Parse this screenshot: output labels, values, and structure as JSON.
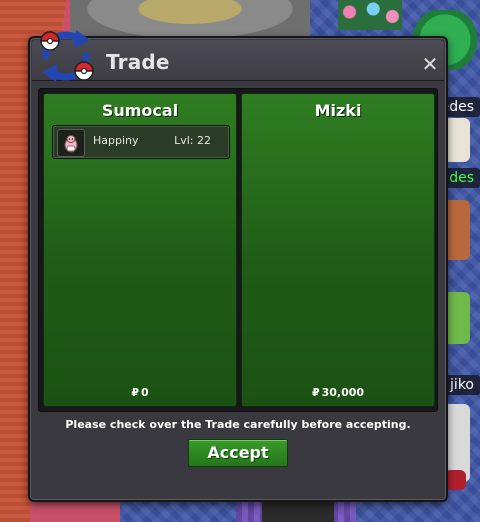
{
  "window": {
    "title": "Trade",
    "close_label": "✕"
  },
  "offers": {
    "left": {
      "player_name": "Sumocal",
      "pokemon": [
        {
          "name": "Happiny",
          "level": "Lvl: 22",
          "icon": "happiny-icon"
        }
      ],
      "currency_symbol": "₽",
      "money": "0"
    },
    "right": {
      "player_name": "Mizki",
      "pokemon": [],
      "currency_symbol": "₽",
      "money": "30,000"
    }
  },
  "notice": "Please check over the Trade carefully before accepting.",
  "accept_label": "Accept",
  "background_nametags": [
    "edes",
    "des",
    "jiko"
  ],
  "colors": {
    "panel_green": "#2f7d22",
    "accept_green": "#3a9b2a",
    "window_bg": "#3a3940",
    "nametag_green": "#44ff44"
  }
}
